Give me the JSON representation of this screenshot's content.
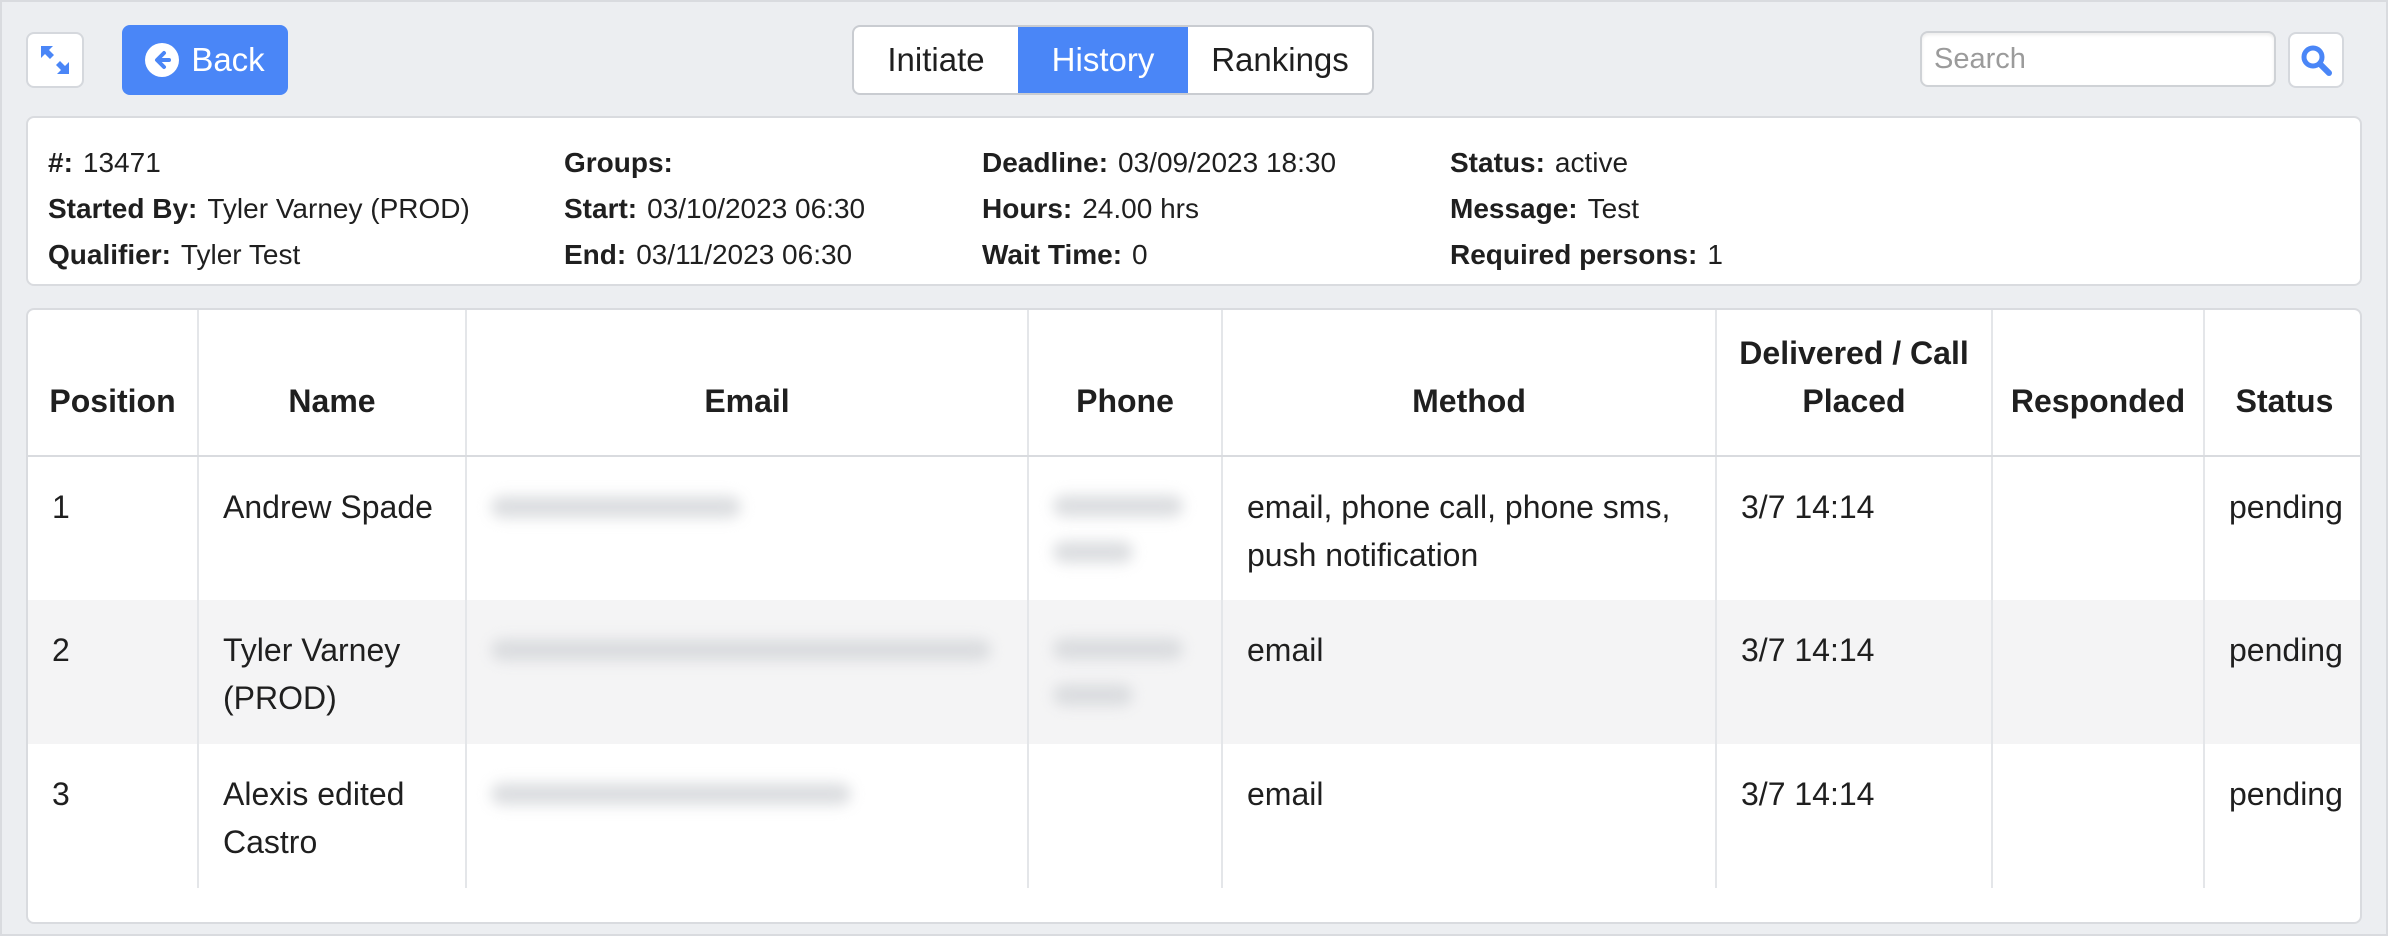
{
  "toolbar": {
    "back_label": "Back",
    "tabs": [
      {
        "label": "Initiate",
        "active": false
      },
      {
        "label": "History",
        "active": true
      },
      {
        "label": "Rankings",
        "active": false
      }
    ],
    "search_placeholder": "Search",
    "accent_color": "#4a86f7"
  },
  "info": {
    "id_label": "#:",
    "id_value": "13471",
    "started_by_label": "Started By:",
    "started_by_value": "Tyler Varney (PROD)",
    "qualifier_label": "Qualifier:",
    "qualifier_value": "Tyler Test",
    "groups_label": "Groups:",
    "groups_value": "",
    "start_label": "Start:",
    "start_value": "03/10/2023 06:30",
    "end_label": "End:",
    "end_value": "03/11/2023 06:30",
    "deadline_label": "Deadline:",
    "deadline_value": "03/09/2023 18:30",
    "hours_label": "Hours:",
    "hours_value": "24.00 hrs",
    "wait_label": "Wait Time:",
    "wait_value": "0",
    "status_label": "Status:",
    "status_value": "active",
    "message_label": "Message:",
    "message_value": "Test",
    "required_label": "Required persons:",
    "required_value": "1"
  },
  "table": {
    "headers": {
      "position": "Position",
      "name": "Name",
      "email": "Email",
      "phone": "Phone",
      "method": "Method",
      "delivered": "Delivered / Call Placed",
      "responded": "Responded",
      "status": "Status"
    },
    "rows": [
      {
        "position": "1",
        "name": "Andrew Spade",
        "method": "email, phone call, phone sms, push notification",
        "delivered": "3/7 14:14",
        "responded": "",
        "status": "pending"
      },
      {
        "position": "2",
        "name": "Tyler Varney (PROD)",
        "method": "email",
        "delivered": "3/7 14:14",
        "responded": "",
        "status": "pending"
      },
      {
        "position": "3",
        "name": "Alexis edited Castro",
        "method": "email",
        "delivered": "3/7 14:14",
        "responded": "",
        "status": "pending"
      }
    ]
  }
}
